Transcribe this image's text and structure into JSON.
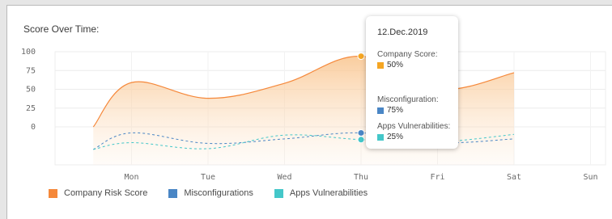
{
  "title": "Score Over Time:",
  "chart_data": {
    "type": "line",
    "categories": [
      "Mon",
      "Tue",
      "Wed",
      "Thu",
      "Fri",
      "Sat",
      "Sun"
    ],
    "y_ticks": [
      "100",
      "75",
      "50",
      "25",
      "0"
    ],
    "ylim": [
      0,
      100
    ],
    "grid": true,
    "legend_position": "bottom-left",
    "series": [
      {
        "name": "Company Risk Score",
        "color": "#f5883a",
        "style": "solid-area",
        "x": [
          0.5,
          1,
          2,
          3,
          4,
          5,
          6
        ],
        "values": [
          0,
          59,
          38,
          58,
          94,
          50,
          72
        ]
      },
      {
        "name": "Misconfigurations",
        "color": "#4a86c5",
        "style": "dashed",
        "x": [
          0.5,
          1,
          2,
          3,
          4,
          5,
          6
        ],
        "values": [
          -30,
          -8,
          -22,
          -16,
          -8,
          -21,
          -16
        ]
      },
      {
        "name": "Apps Vulnerabilities",
        "color": "#44c7c9",
        "style": "dashed",
        "x": [
          0.5,
          1,
          2,
          3,
          4,
          5,
          6
        ],
        "values": [
          -30,
          -21,
          -29,
          -11,
          -17,
          -20,
          -10
        ]
      }
    ]
  },
  "tooltip": {
    "date": "12.Dec.2019",
    "items": [
      {
        "label": "Company Score:",
        "value": "50%",
        "color": "#f5a623"
      },
      {
        "label": "Misconfiguration:",
        "value": "75%",
        "color": "#4a86c5"
      },
      {
        "label": "Apps Vulnerabilities:",
        "value": "25%",
        "color": "#44c7c9"
      }
    ]
  },
  "legend": [
    {
      "label": "Company Risk Score",
      "color": "#f5883a"
    },
    {
      "label": "Misconfigurations",
      "color": "#4a86c5"
    },
    {
      "label": "Apps Vulnerabilities",
      "color": "#44c7c9"
    }
  ]
}
